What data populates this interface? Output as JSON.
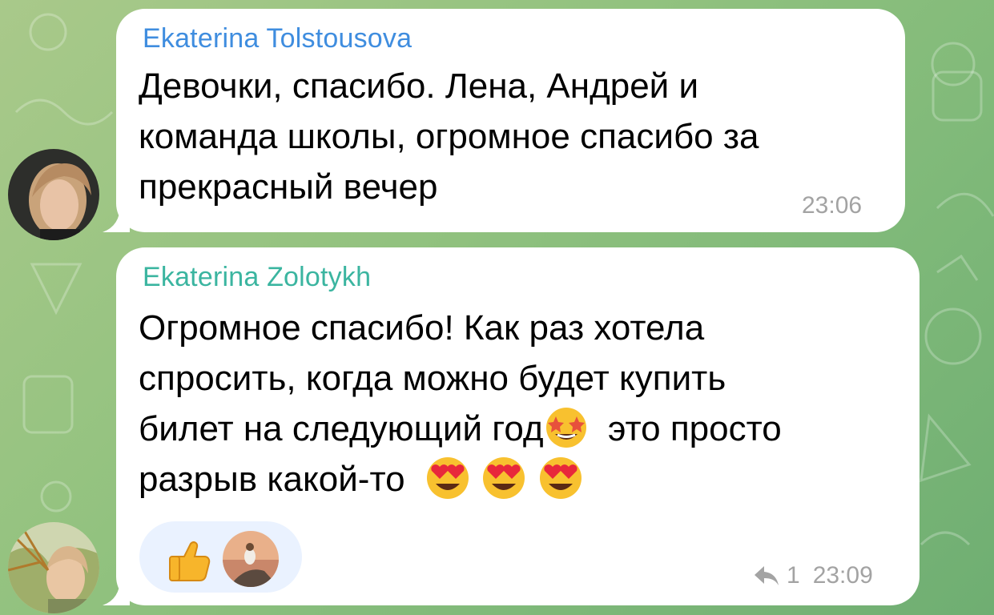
{
  "colors": {
    "bubble": "#ffffff",
    "sender1": "#3f8ddf",
    "sender2": "#3bb5a0",
    "meta": "#a3a3a3",
    "reactions_bg": "#eaf2ff"
  },
  "messages": [
    {
      "sender": "Ekaterina Tolstousova",
      "lines": [
        "Девочки, спасибо. Лена, Андрей и",
        "команда школы, огромное спасибо за",
        "прекрасный вечер"
      ],
      "time": "23:06"
    },
    {
      "sender": "Ekaterina Zolotykh",
      "lines": [
        "Огромное спасибо! Как раз хотела",
        "спросить, когда можно будет купить",
        "билет на следующий год",
        "это просто",
        "разрыв какой-то"
      ],
      "emojis": [
        "star-struck-emoji",
        "heart-eyes-emoji"
      ],
      "reactions": [
        "thumbs-up-icon",
        "reactor-avatar"
      ],
      "reply_count": "1",
      "time": "23:09"
    }
  ]
}
